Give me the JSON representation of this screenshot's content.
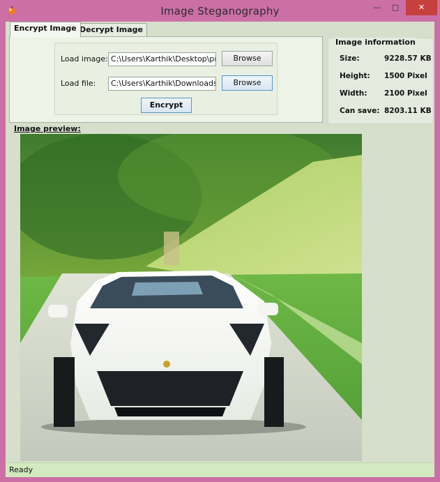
{
  "window": {
    "title": "Image  Steganography",
    "min_glyph": "—",
    "max_glyph": "□",
    "close_glyph": "✕"
  },
  "tabs": [
    {
      "label": "Encrypt Image",
      "active": true
    },
    {
      "label": "Decrypt Image",
      "active": false
    }
  ],
  "encrypt": {
    "load_image_label": "Load image:",
    "load_image_value": "C:\\Users\\Karthik\\Desktop\\proje",
    "load_file_label": "Load file:",
    "load_file_value": "C:\\Users\\Karthik\\Downloads\\D",
    "browse_label": "Browse",
    "browse2_label": "Browse",
    "encrypt_label": "Encrypt"
  },
  "image_info": {
    "title": "Image information",
    "size_label": "Size:",
    "size_value": "9228.57 KB",
    "height_label": "Height:",
    "height_value": "1500 Pixel",
    "width_label": "Width:",
    "width_value": "2100 Pixel",
    "cansave_label": "Can save:",
    "cansave_value": "8203.11 KB"
  },
  "preview": {
    "label": "Image preview:"
  },
  "status": {
    "text": "Ready"
  },
  "colors": {
    "frame": "#cc6fa7",
    "client": "#d6dfcc",
    "close": "#c6403d",
    "status": "#d3eac0"
  }
}
